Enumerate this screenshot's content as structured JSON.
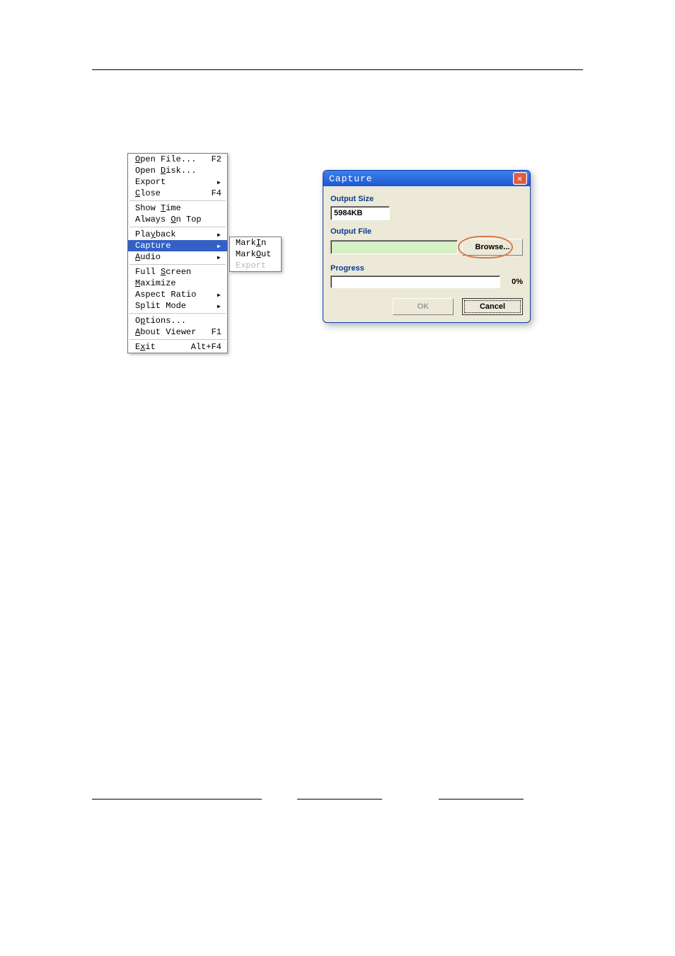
{
  "menu": {
    "items": [
      {
        "pre": "",
        "accel": "O",
        "post": "pen File...",
        "shortcut": "F2",
        "submenu": false,
        "hl": false,
        "disabled": false
      },
      {
        "pre": "Open ",
        "accel": "D",
        "post": "isk...",
        "shortcut": "",
        "submenu": false,
        "hl": false,
        "disabled": false
      },
      {
        "pre": "Export",
        "accel": "",
        "post": "",
        "shortcut": "",
        "submenu": true,
        "hl": false,
        "disabled": false
      },
      {
        "pre": "",
        "accel": "C",
        "post": "lose",
        "shortcut": "F4",
        "submenu": false,
        "hl": false,
        "disabled": false
      },
      {
        "sep": true
      },
      {
        "pre": "Show ",
        "accel": "T",
        "post": "ime",
        "shortcut": "",
        "submenu": false,
        "hl": false,
        "disabled": false
      },
      {
        "pre": "Always ",
        "accel": "O",
        "post": "n Top",
        "shortcut": "",
        "submenu": false,
        "hl": false,
        "disabled": false
      },
      {
        "sep": true
      },
      {
        "pre": "Pla",
        "accel": "y",
        "post": "back",
        "shortcut": "",
        "submenu": true,
        "hl": false,
        "disabled": false
      },
      {
        "pre": "Capture",
        "accel": "",
        "post": "",
        "shortcut": "",
        "submenu": true,
        "hl": true,
        "disabled": false
      },
      {
        "pre": "",
        "accel": "A",
        "post": "udio",
        "shortcut": "",
        "submenu": true,
        "hl": false,
        "disabled": false
      },
      {
        "sep": true
      },
      {
        "pre": "Full ",
        "accel": "S",
        "post": "creen",
        "shortcut": "",
        "submenu": false,
        "hl": false,
        "disabled": false
      },
      {
        "pre": "",
        "accel": "M",
        "post": "aximize",
        "shortcut": "",
        "submenu": false,
        "hl": false,
        "disabled": false
      },
      {
        "pre": "Aspect Ratio",
        "accel": "",
        "post": "",
        "shortcut": "",
        "submenu": true,
        "hl": false,
        "disabled": false
      },
      {
        "pre": "Split Mode",
        "accel": "",
        "post": "",
        "shortcut": "",
        "submenu": true,
        "hl": false,
        "disabled": false
      },
      {
        "sep": true
      },
      {
        "pre": "O",
        "accel": "p",
        "post": "tions...",
        "shortcut": "",
        "submenu": false,
        "hl": false,
        "disabled": false
      },
      {
        "pre": "",
        "accel": "A",
        "post": "bout Viewer",
        "shortcut": "F1",
        "submenu": false,
        "hl": false,
        "disabled": false
      },
      {
        "sep": true
      },
      {
        "pre": "E",
        "accel": "x",
        "post": "it",
        "shortcut": "Alt+F4",
        "submenu": false,
        "hl": false,
        "disabled": false
      }
    ],
    "submenu": [
      {
        "pre": "Mark ",
        "accel": "I",
        "post": "n",
        "disabled": false
      },
      {
        "pre": "Mark ",
        "accel": "O",
        "post": "ut",
        "disabled": false
      },
      {
        "pre": "Export",
        "accel": "",
        "post": "",
        "disabled": true
      }
    ]
  },
  "dialog": {
    "title": "Capture",
    "close_glyph": "✕",
    "output_size_label": "Output Size",
    "output_size_value": "5984KB",
    "output_file_label": "Output File",
    "output_file_value": "",
    "browse_label": "Browse...",
    "progress_label": "Progress",
    "progress_percent": "0%",
    "ok_label": "OK",
    "cancel_label": "Cancel"
  }
}
